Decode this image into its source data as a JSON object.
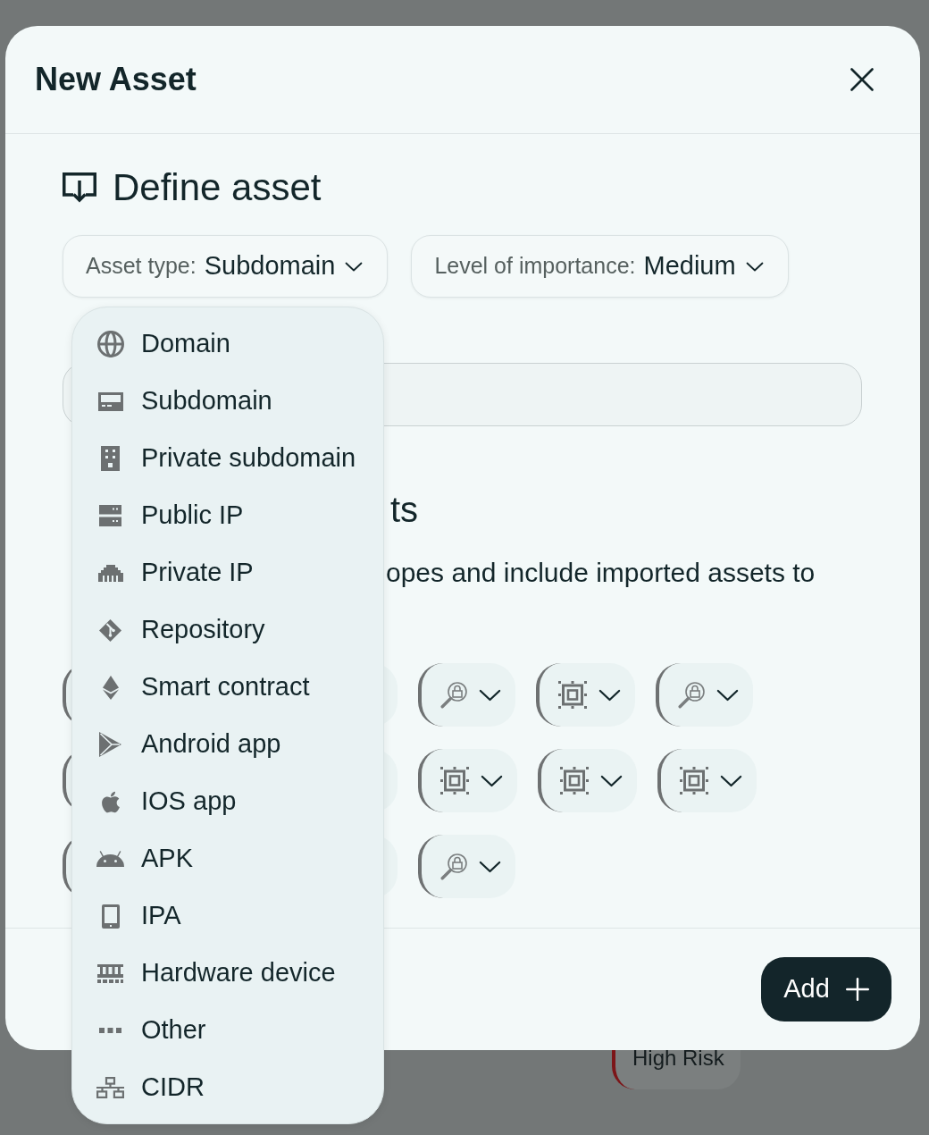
{
  "modal": {
    "title": "New Asset"
  },
  "define_section": {
    "heading": "Define asset",
    "selects": [
      {
        "label": "Asset type:",
        "value": "Subdomain"
      },
      {
        "label": "Level of importance:",
        "value": "Medium"
      }
    ]
  },
  "asset_type_menu": {
    "items": [
      {
        "label": "Domain",
        "kind": "domain"
      },
      {
        "label": "Subdomain",
        "kind": "subdomain"
      },
      {
        "label": "Private subdomain",
        "kind": "privatesubdomain"
      },
      {
        "label": "Public IP",
        "kind": "publicip"
      },
      {
        "label": "Private IP",
        "kind": "privateip"
      },
      {
        "label": "Repository",
        "kind": "repository"
      },
      {
        "label": "Smart contract",
        "kind": "contract"
      },
      {
        "label": "Android app",
        "kind": "android"
      },
      {
        "label": "IOS app",
        "kind": "ios"
      },
      {
        "label": "APK",
        "kind": "apk"
      },
      {
        "label": "IPA",
        "kind": "ipa"
      },
      {
        "label": "Hardware device",
        "kind": "hardware"
      },
      {
        "label": "Other",
        "kind": "other"
      },
      {
        "label": "CIDR",
        "kind": "cidr"
      }
    ]
  },
  "scope_section": {
    "heading": "ts",
    "description": "opes and include imported assets to",
    "rows": [
      {
        "chips": [
          {
            "kind": "covered"
          },
          {
            "kind": "search"
          },
          {
            "kind": "frame"
          },
          {
            "kind": "search"
          }
        ]
      },
      {
        "chips": [
          {
            "kind": "covered"
          },
          {
            "kind": "frame"
          },
          {
            "kind": "frame"
          },
          {
            "kind": "frame"
          }
        ]
      },
      {
        "chips": [
          {
            "kind": "covered"
          },
          {
            "kind": "search"
          }
        ]
      }
    ]
  },
  "footer": {
    "button": "Add"
  },
  "background_page": {
    "tag": "High Risk"
  }
}
